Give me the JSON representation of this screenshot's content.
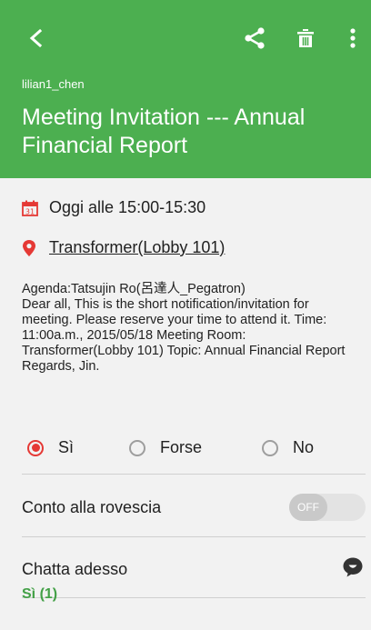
{
  "header": {
    "username": "lilian1_chen",
    "title": "Meeting Invitation --- Annual Financial Report",
    "back_icon": "back-arrow-icon",
    "share_icon": "share-icon",
    "delete_icon": "trash-icon",
    "more_icon": "more-vert-icon",
    "color": "#4caf50"
  },
  "event": {
    "datetime": "Oggi alle 15:00-15:30",
    "location": "Transformer(Lobby 101)",
    "description": "Agenda:Tatsujin Ro(呂達人_Pegatron)\nDear all, This is the short notification/invitation for meeting. Please reserve your time to attend it. Time: 11:00a.m., 2015/05/18 Meeting Room: Transformer(Lobby 101) Topic: Annual Financial Report Regards, Jin."
  },
  "rsvp": {
    "options": [
      "Sì",
      "Forse",
      "No"
    ],
    "selected": "Sì",
    "accent": "#e53935"
  },
  "settings": {
    "countdown_label": "Conto alla rovescia",
    "countdown_toggle": "OFF",
    "chat_label": "Chatta adesso"
  },
  "attendees": {
    "yes_header": "Sì (1)",
    "accent": "#43a047"
  }
}
